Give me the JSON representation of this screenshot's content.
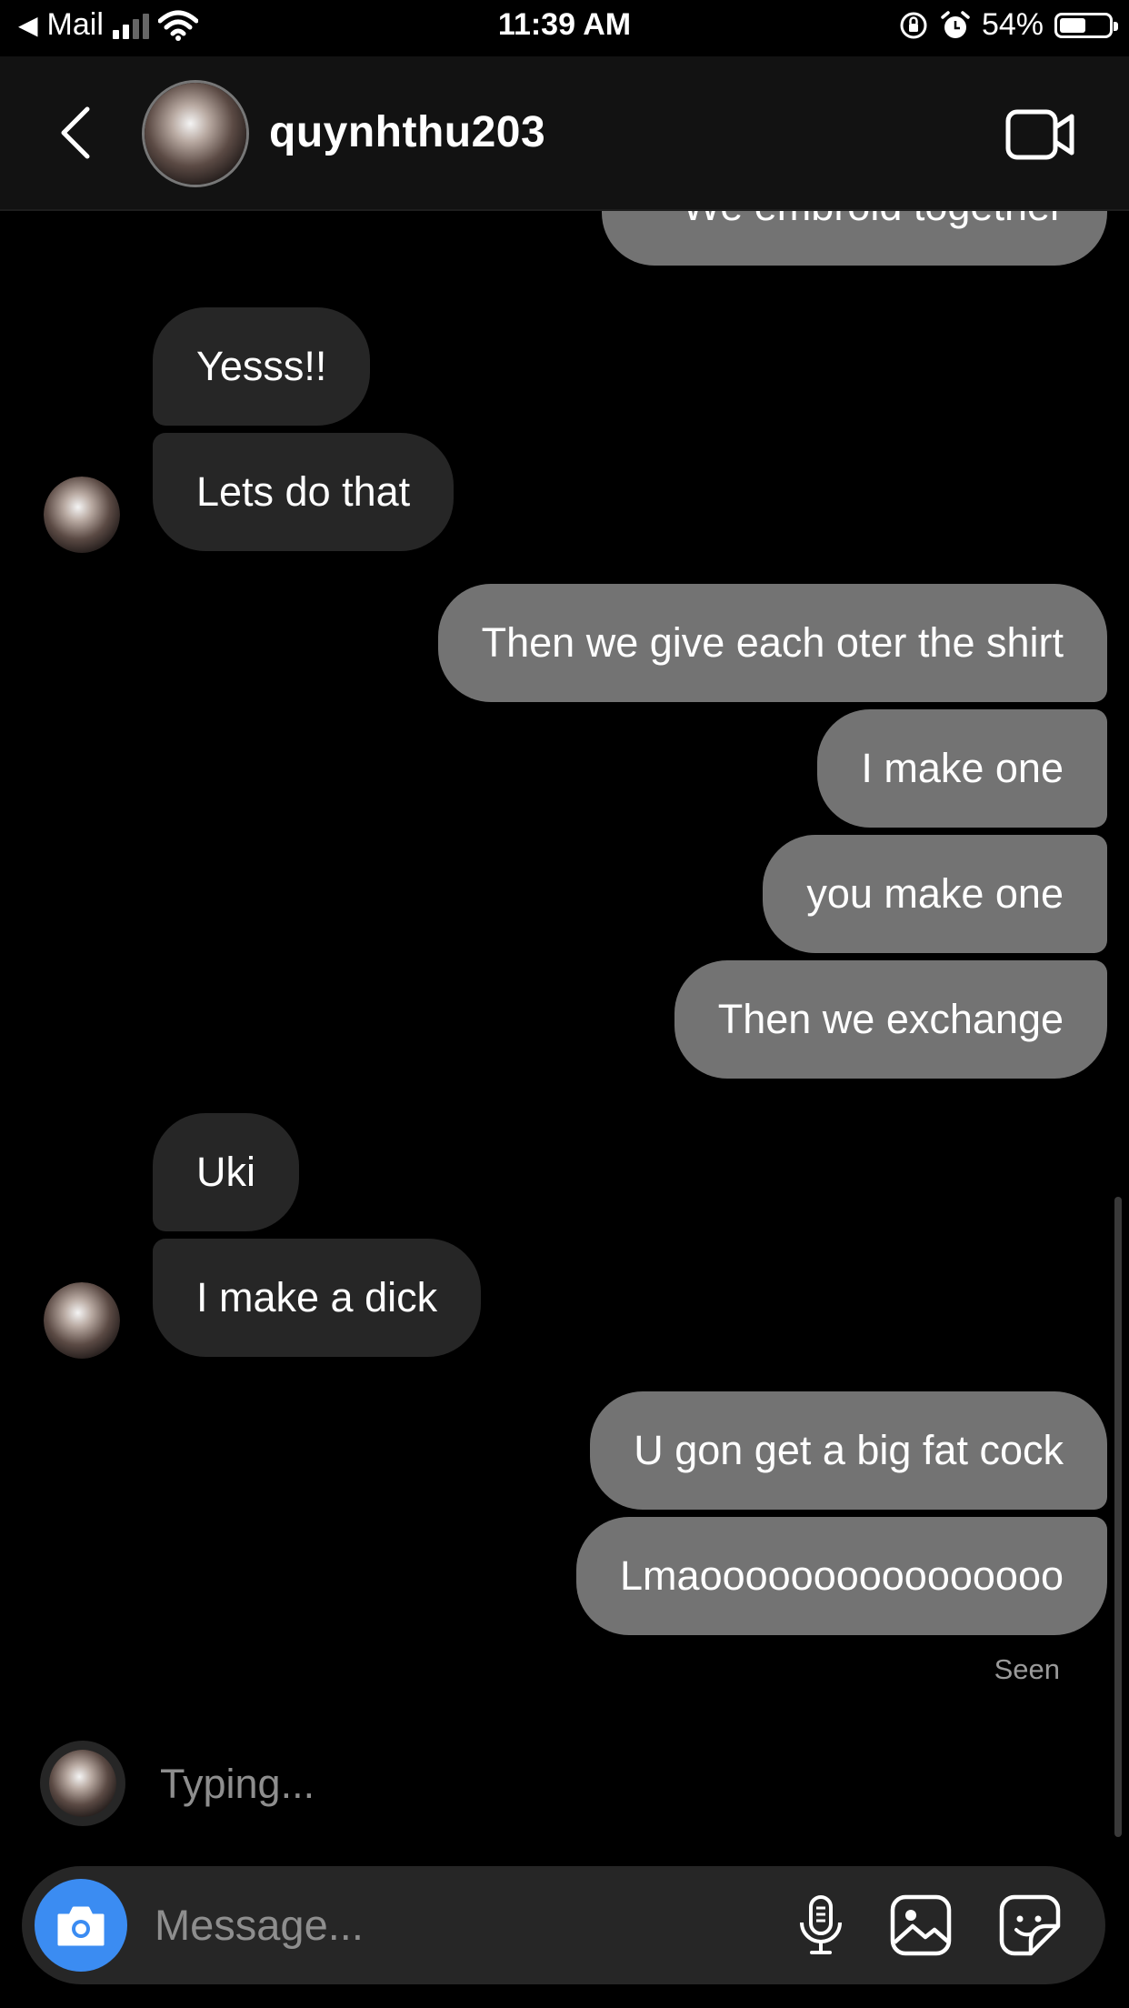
{
  "status_bar": {
    "back_app": "Mail",
    "time": "11:39 AM",
    "battery_text": "54%",
    "battery_level": 0.54,
    "signal_bars": 2,
    "icons": [
      "signal-icon",
      "wifi-icon",
      "orientation-lock-icon",
      "alarm-icon",
      "battery-icon"
    ]
  },
  "header": {
    "username": "quynhthu203",
    "back_icon": "chevron-left-icon",
    "video_icon": "video-call-icon"
  },
  "messages": [
    {
      "from": "me",
      "text": "We embroid together"
    },
    {
      "from": "them",
      "text": "Yesss!!"
    },
    {
      "from": "them",
      "text": "Lets do that"
    },
    {
      "from": "me",
      "text": "Then we give each oter the shirt"
    },
    {
      "from": "me",
      "text": "I make one"
    },
    {
      "from": "me",
      "text": "you make one"
    },
    {
      "from": "me",
      "text": "Then we exchange"
    },
    {
      "from": "them",
      "text": "Uki"
    },
    {
      "from": "them",
      "text": "I make a dick"
    },
    {
      "from": "me",
      "text": "U gon get a big fat cock"
    },
    {
      "from": "me",
      "text": "Lmaoooooooooooooooo"
    }
  ],
  "seen_label": "Seen",
  "typing_label": "Typing...",
  "composer": {
    "placeholder": "Message...",
    "camera_icon": "camera-icon",
    "mic_icon": "microphone-icon",
    "gallery_icon": "gallery-icon",
    "sticker_icon": "sticker-icon"
  },
  "colors": {
    "background": "#000000",
    "header": "#121212",
    "received_bubble": "#262626",
    "sent_bubble": "#737373",
    "camera_button": "#3b8cf2"
  }
}
